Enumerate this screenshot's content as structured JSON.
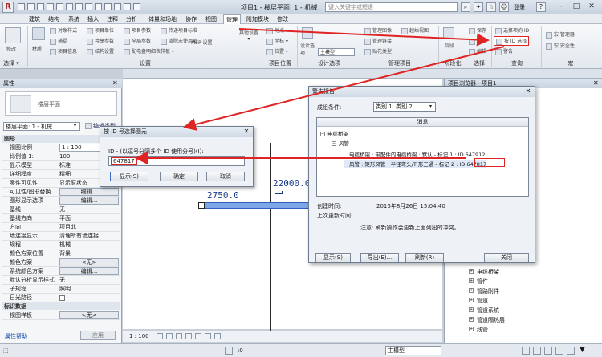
{
  "window": {
    "title": "项目1 - 楼层平面: 1 - 机械",
    "search_placeholder": "键入关键字或短语",
    "login_label": "登录"
  },
  "menu_tabs": [
    "建筑",
    "结构",
    "系统",
    "插入",
    "注释",
    "分析",
    "体量和场地",
    "协作",
    "视图",
    "管理",
    "附加模块",
    "修改"
  ],
  "active_tab": "管理",
  "ribbon": {
    "groups": {
      "select": "选择 ▾",
      "settings": "设置",
      "project_location": "项目位置",
      "design_options": "设计选项",
      "manage_project": "管理项目",
      "phasing": "阶段化",
      "selection": "选择",
      "inquiry": "查询",
      "macros": "宏"
    },
    "modify_label": "修改",
    "materials_label": "材质",
    "settings_items": [
      [
        "对象样式",
        "项目单位",
        "项目参数",
        "传递项目标准",
        "清除未使用项"
      ],
      [
        "捕捉",
        "共享参数",
        "全局参数",
        "项目浏览器",
        "MEP 设置"
      ],
      [
        "项目信息",
        "共享参数",
        "结构设置",
        "配电盘明细表样板 ▾",
        "其他设置 ▾"
      ]
    ],
    "location_items": [
      "地点",
      "坐标 ▾",
      "位置 ▾"
    ],
    "design_option_items": [
      "设计选项",
      "主模型"
    ],
    "manage_project_items": [
      "管理图像",
      "管理链接",
      "贴花类型",
      "启动视图",
      "起始视图"
    ],
    "phasing_label": "阶段",
    "selection_items": [
      "保存",
      "载入",
      "编辑"
    ],
    "inquiry_items": [
      "选择项的 ID",
      "按 ID 选择",
      "警告"
    ],
    "macros_items": [
      "宏 管理器",
      "宏 安全性"
    ]
  },
  "properties": {
    "panel_title": "属性",
    "type_label": "楼层平面",
    "selector_value": "楼层平面: 1 - 机械",
    "edit_type_label": "编辑类型",
    "group_graphics": "图形",
    "rows": [
      {
        "key": "视图比例",
        "value": "1 : 100",
        "style": "box"
      },
      {
        "key": "比例值 1:",
        "value": "100",
        "style": "plain"
      },
      {
        "key": "显示模型",
        "value": "标准",
        "style": "plain"
      },
      {
        "key": "详细程度",
        "value": "精细",
        "style": "plain"
      },
      {
        "key": "零件可见性",
        "value": "显示原状态",
        "style": "plain"
      },
      {
        "key": "可见性/图形替换",
        "value": "编辑...",
        "style": "btn"
      },
      {
        "key": "图形显示选项",
        "value": "编辑...",
        "style": "btn"
      },
      {
        "key": "基线",
        "value": "无",
        "style": "plain"
      },
      {
        "key": "基线方向",
        "value": "平面",
        "style": "plain"
      },
      {
        "key": "方向",
        "value": "项目北",
        "style": "plain"
      },
      {
        "key": "墙连接显示",
        "value": "清理所有墙连接",
        "style": "plain"
      },
      {
        "key": "规程",
        "value": "机械",
        "style": "plain"
      },
      {
        "key": "颜色方案位置",
        "value": "背景",
        "style": "plain"
      },
      {
        "key": "颜色方案",
        "value": "<无>",
        "style": "btn"
      },
      {
        "key": "系统颜色方案",
        "value": "编辑...",
        "style": "btn"
      },
      {
        "key": "默认分析显示样式",
        "value": "无",
        "style": "plain"
      },
      {
        "key": "子规程",
        "value": "照明",
        "style": "plain"
      },
      {
        "key": "日光路径",
        "value": "",
        "style": "check"
      }
    ],
    "group_identity": "标识数据",
    "view_template_key": "视图样板",
    "view_template_value": "<无>",
    "help_link": "属性帮助",
    "apply_label": "应用"
  },
  "canvas": {
    "dim_left": "2750.0",
    "dim_right": "22000.0",
    "scale_label": "1 : 100"
  },
  "project_browser": {
    "title": "项目浏览器 - 项目1",
    "items": [
      "电缆桥架",
      "管件",
      "管路附件",
      "管道",
      "管道系统",
      "管道隔热层",
      "线管"
    ]
  },
  "select_by_id_dialog": {
    "title": "按 ID 号选择图元",
    "label": "ID - (以逗号分隔多个 ID 使用分号)(I):",
    "value": "647817",
    "show_button": "显示(S)",
    "ok_button": "确定",
    "cancel_button": "取消"
  },
  "warning_dialog": {
    "title": "警告报告",
    "group_label": "成组条件:",
    "group_value": "类别 1, 类别 2",
    "column_header": "消息",
    "tree": [
      {
        "level": 0,
        "text": "电缆桥架"
      },
      {
        "level": 1,
        "text": "风管"
      },
      {
        "level": 2,
        "text": "电缆桥架 : 带配件的电缆桥架 : 默认 - 标记 1 : ID 647912"
      },
      {
        "level": 2,
        "text": "风管 : 矩形风管 : 半径弯头/T 形三通 - 标记 2 : ID 647817"
      }
    ],
    "created_label": "创建时间:",
    "created_value": "2016年8月26日 15:04:40",
    "last_updated_label": "上次更新时间:",
    "note": "注意: 刷新操作会更新上面列出的冲突。",
    "show_button": "显示(S)",
    "export_button": "导出(E)...",
    "refresh_button": "刷新(R)",
    "close_button": "关闭"
  },
  "colors": {
    "highlight": "#e02323",
    "duct": "#7fa6e6"
  }
}
